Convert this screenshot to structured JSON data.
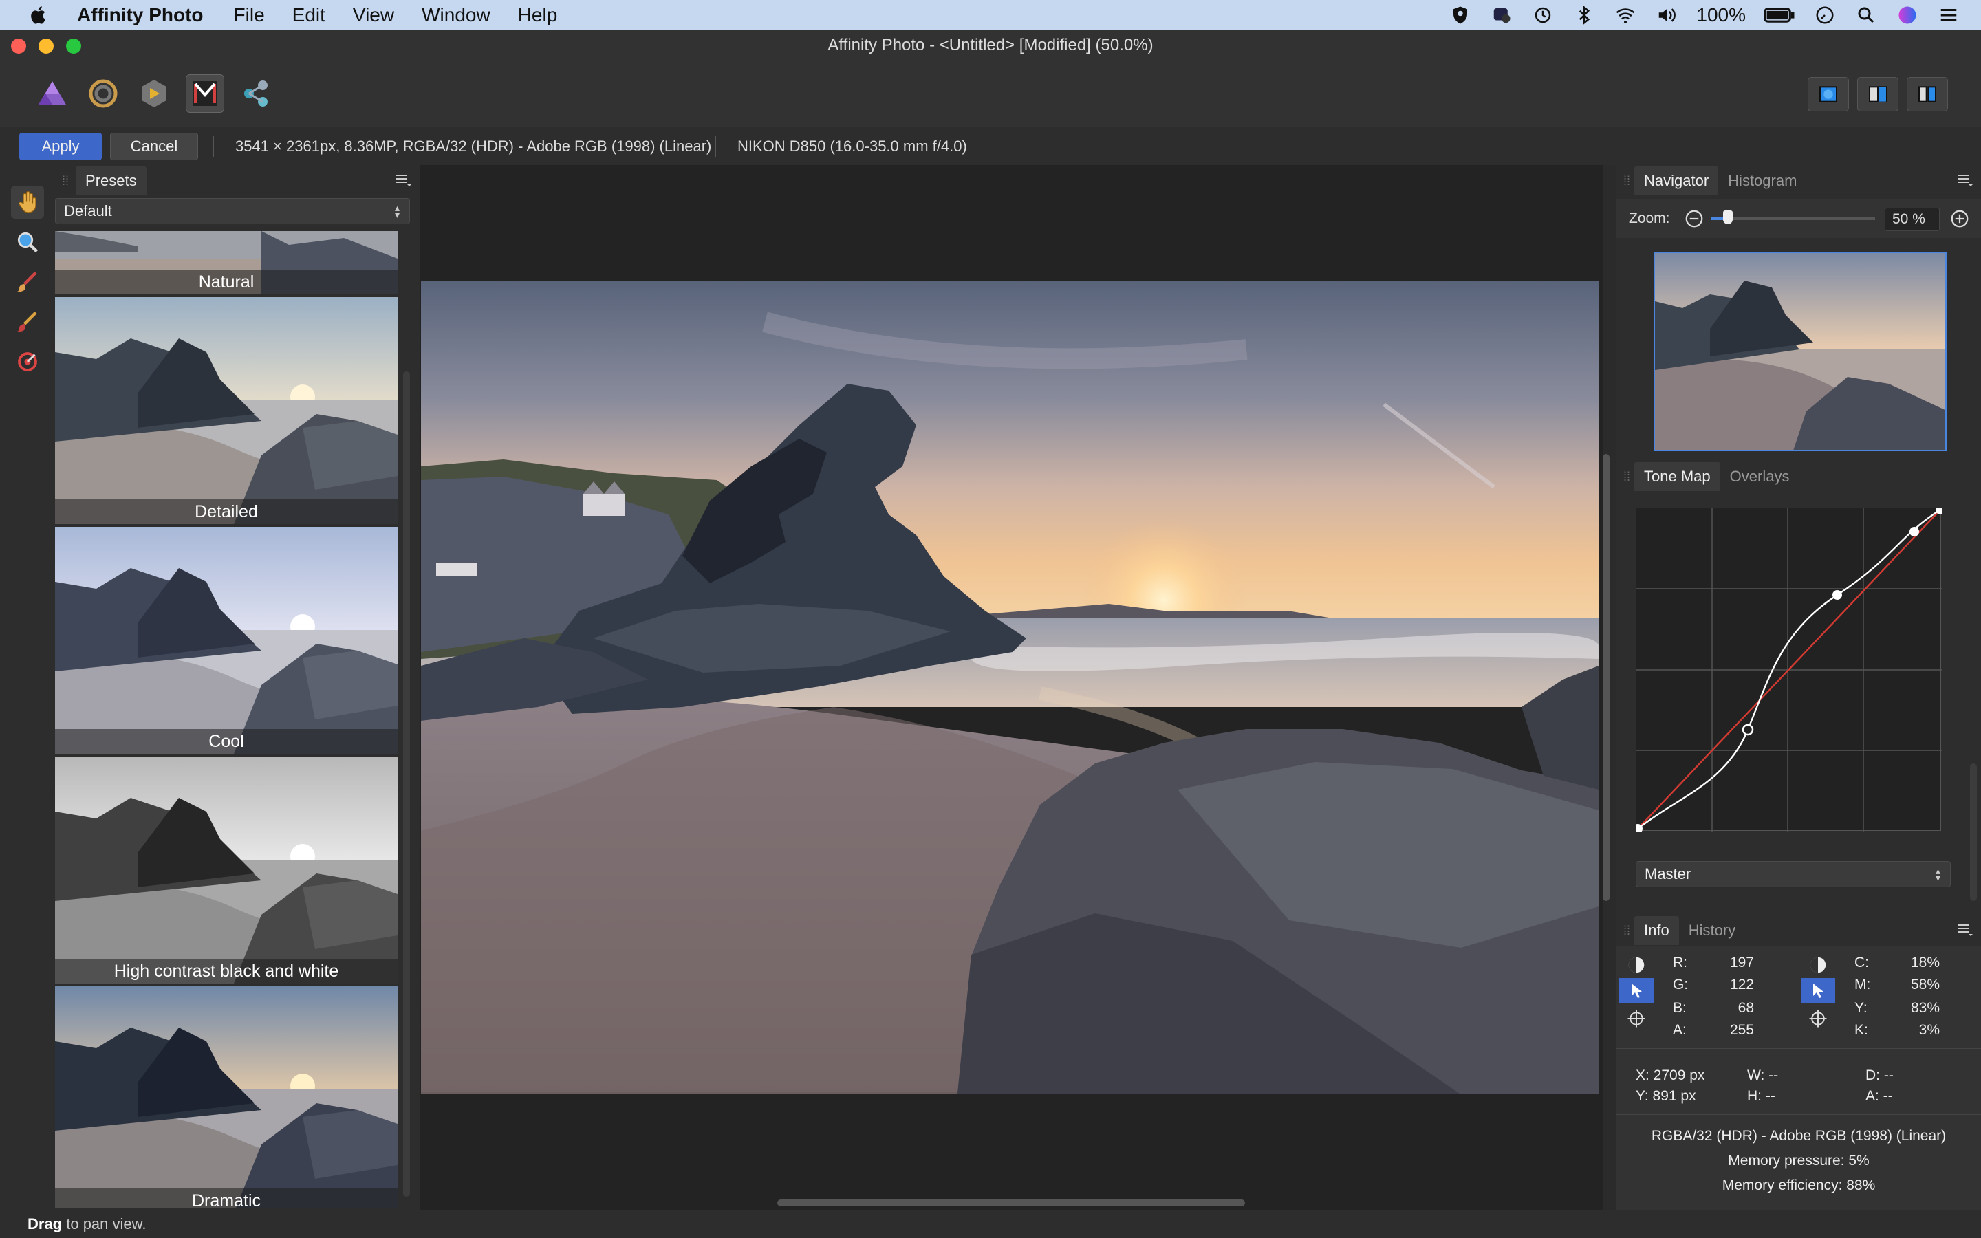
{
  "menubar": {
    "app_name": "Affinity Photo",
    "items": [
      "File",
      "Edit",
      "View",
      "Window",
      "Help"
    ],
    "battery": "100%"
  },
  "window": {
    "title": "Affinity Photo - <Untitled> [Modified] (50.0%)"
  },
  "contextbar": {
    "apply_label": "Apply",
    "cancel_label": "Cancel",
    "doc_info": "3541 × 2361px, 8.36MP, RGBA/32 (HDR) - Adobe RGB (1998) (Linear)",
    "camera_info": "NIKON D850 (16.0-35.0 mm f/4.0)"
  },
  "presets": {
    "tab_label": "Presets",
    "category": "Default",
    "items": [
      {
        "label": "Natural"
      },
      {
        "label": "Detailed"
      },
      {
        "label": "Cool"
      },
      {
        "label": "High contrast black and white"
      },
      {
        "label": "Dramatic"
      }
    ]
  },
  "navigator": {
    "tabs": [
      "Navigator",
      "Histogram"
    ],
    "zoom_label": "Zoom:",
    "zoom_value": "50 %",
    "zoom_fraction": 0.1
  },
  "tonemap": {
    "tabs": [
      "Tone Map",
      "Overlays"
    ],
    "channel": "Master"
  },
  "info": {
    "tabs": [
      "Info",
      "History"
    ],
    "rgb": {
      "R": "197",
      "G": "122",
      "B": "68",
      "A": "255"
    },
    "cmyk": {
      "C": "18%",
      "M": "58%",
      "Y": "83%",
      "K": "3%"
    },
    "x": "X: 2709 px",
    "y": "Y: 891 px",
    "w": "W: --",
    "h": "H: --",
    "d": "D: --",
    "a": "A: --",
    "colorspace": "RGBA/32 (HDR) - Adobe RGB (1998) (Linear)",
    "memory_pressure": "Memory pressure: 5%",
    "memory_efficiency": "Memory efficiency: 88%"
  },
  "statusbar": {
    "bold": "Drag",
    "rest": " to pan view."
  },
  "colors": {
    "accent": "#3d67c9",
    "curve_red": "#d23a32",
    "menubar": "#c6d8f0"
  }
}
